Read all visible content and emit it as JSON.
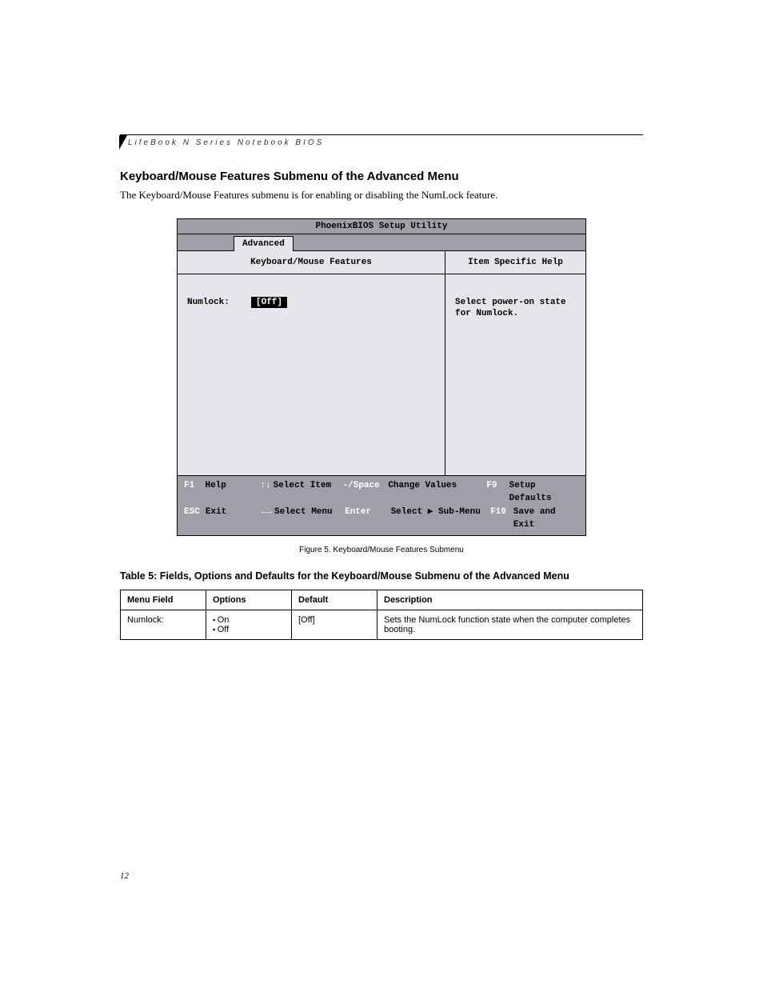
{
  "header": {
    "running": "LifeBook N Series Notebook BIOS"
  },
  "section": {
    "title": "Keyboard/Mouse Features Submenu of the Advanced Menu",
    "intro": "The Keyboard/Mouse Features submenu is for enabling or disabling the NumLock feature."
  },
  "bios": {
    "title": "PhoenixBIOS Setup Utility",
    "tab": "Advanced",
    "left_heading": "Keyboard/Mouse Features",
    "right_heading": "Item Specific Help",
    "field_label": "Numlock:",
    "field_value": "[Off]",
    "help_line1": "Select power-on state",
    "help_line2": "for Numlock.",
    "footer": {
      "f1": "F1",
      "f1a": "Help",
      "ud": "↑↓",
      "uda": "Select Item",
      "sp": "-/Space",
      "spa": "Change Values",
      "f9": "F9",
      "f9a": "Setup Defaults",
      "esc": "ESC",
      "esca": "Exit",
      "lr": "←→",
      "lra": "Select Menu",
      "ent": "Enter",
      "enta": "Select ▶ Sub-Menu",
      "f10": "F10",
      "f10a": "Save and Exit"
    }
  },
  "figure_caption": "Figure 5.  Keyboard/Mouse Features Submenu",
  "table_caption": "Table 5: Fields, Options and Defaults for the Keyboard/Mouse Submenu of the Advanced Menu",
  "table": {
    "h1": "Menu Field",
    "h2": "Options",
    "h3": "Default",
    "h4": "Description",
    "r1c1": "Numlock:",
    "r1c2a": "On",
    "r1c2b": "Off",
    "r1c3": "[Off]",
    "r1c4": "Sets the NumLock function state when the computer completes booting."
  },
  "page_number": "12"
}
